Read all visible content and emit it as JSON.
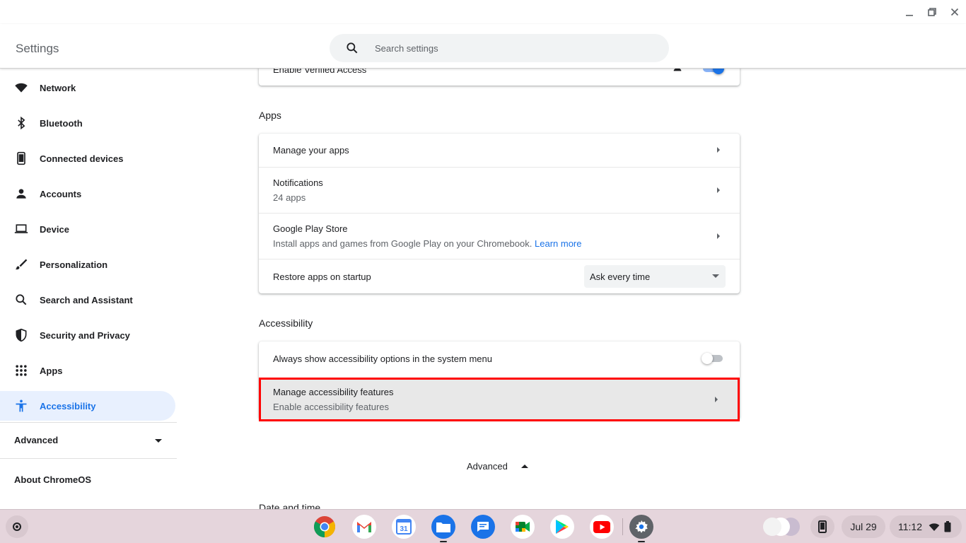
{
  "window": {
    "title": "Settings",
    "controls": [
      "minimize",
      "maximize",
      "close"
    ]
  },
  "search": {
    "placeholder": "Search settings"
  },
  "sidebar": {
    "items": [
      {
        "label": "Network",
        "icon": "wifi-icon"
      },
      {
        "label": "Bluetooth",
        "icon": "bluetooth-icon"
      },
      {
        "label": "Connected devices",
        "icon": "phone-icon"
      },
      {
        "label": "Accounts",
        "icon": "person-icon"
      },
      {
        "label": "Device",
        "icon": "laptop-icon"
      },
      {
        "label": "Personalization",
        "icon": "brush-icon"
      },
      {
        "label": "Search and Assistant",
        "icon": "search-icon"
      },
      {
        "label": "Security and Privacy",
        "icon": "shield-icon"
      },
      {
        "label": "Apps",
        "icon": "apps-grid-icon"
      },
      {
        "label": "Accessibility",
        "icon": "accessibility-icon",
        "active": true
      }
    ],
    "advanced": "Advanced",
    "about": "About ChromeOS"
  },
  "main": {
    "top_row": {
      "label": "Enable Verified Access"
    },
    "apps": {
      "title": "Apps",
      "rows": [
        {
          "label": "Manage your apps"
        },
        {
          "label": "Notifications",
          "sub": "24 apps"
        },
        {
          "label": "Google Play Store",
          "sub": "Install apps and games from Google Play on your Chromebook.",
          "link": "Learn more"
        },
        {
          "label": "Restore apps on startup",
          "select_value": "Ask every time"
        }
      ]
    },
    "accessibility": {
      "title": "Accessibility",
      "rows": [
        {
          "label": "Always show accessibility options in the system menu",
          "toggle": false
        },
        {
          "label": "Manage accessibility features",
          "sub": "Enable accessibility features"
        }
      ]
    },
    "advanced_label": "Advanced",
    "next_section": "Date and time"
  },
  "shelf": {
    "apps": [
      "Chrome",
      "Gmail",
      "Calendar",
      "Files",
      "Messages",
      "Meet",
      "Play Store",
      "YouTube",
      "Settings"
    ],
    "calendar_day": "31",
    "date": "Jul 29",
    "time": "11:12"
  },
  "colors": {
    "accent": "#1a73e8",
    "highlight_border": "#ff0000",
    "shelf_bg": "#e5d5dc",
    "active_nav_bg": "#e8f0fe"
  }
}
